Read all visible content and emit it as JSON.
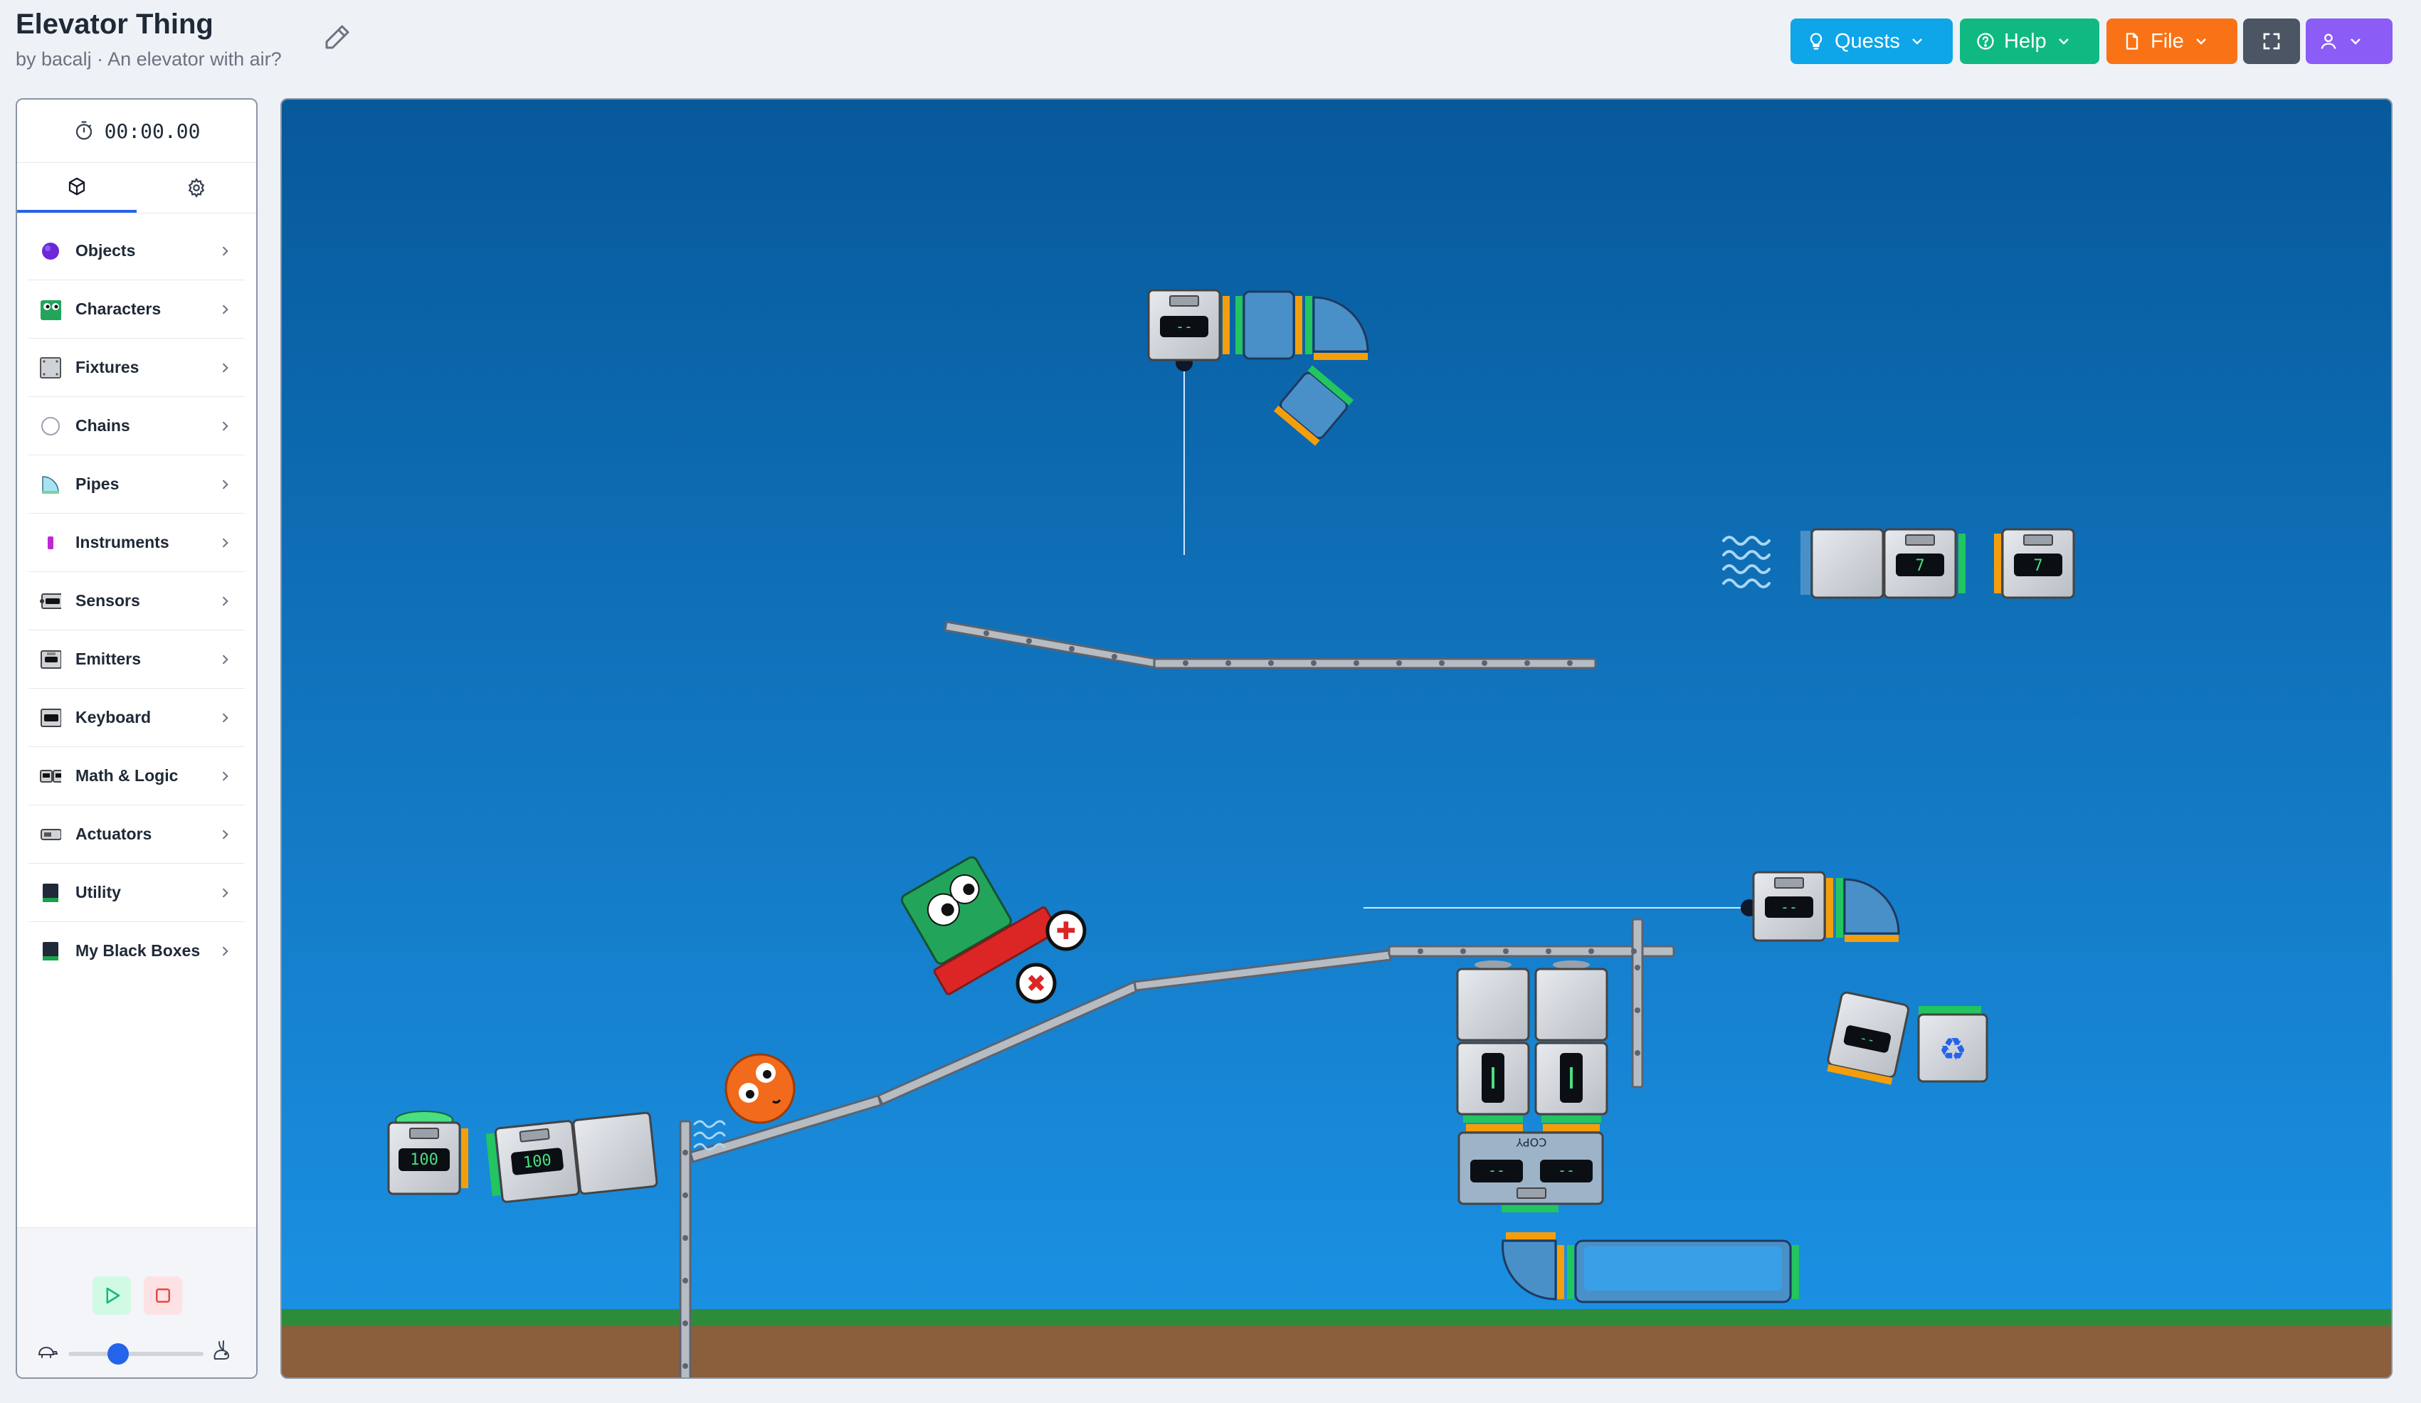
{
  "header": {
    "title": "Elevator Thing",
    "subtitle": "by bacalj · An elevator with air?",
    "edit_icon": "pencil-icon",
    "buttons": [
      {
        "label": "Quests",
        "color": "#0ea5e9",
        "icon": "lightbulb-icon"
      },
      {
        "label": "Help",
        "color": "#10b981",
        "icon": "help-circle-icon"
      },
      {
        "label": "File",
        "color": "#f97316",
        "icon": "file-icon"
      },
      {
        "label": "",
        "color": "#4b5563",
        "icon": "fullscreen-icon"
      },
      {
        "label": "",
        "color": "#8b5cf6",
        "icon": "user-icon"
      }
    ]
  },
  "sidebar": {
    "timer": "00:00.00",
    "tabs": [
      {
        "name": "objects",
        "icon": "cube-icon",
        "active": true
      },
      {
        "name": "settings",
        "icon": "gear-icon",
        "active": false
      }
    ],
    "categories": [
      {
        "label": "Objects",
        "icon": "purple-ball-icon"
      },
      {
        "label": "Characters",
        "icon": "green-character-icon"
      },
      {
        "label": "Fixtures",
        "icon": "fixture-panel-icon"
      },
      {
        "label": "Chains",
        "icon": "chain-ring-icon"
      },
      {
        "label": "Pipes",
        "icon": "pipe-icon"
      },
      {
        "label": "Instruments",
        "icon": "instrument-icon"
      },
      {
        "label": "Sensors",
        "icon": "sensor-icon"
      },
      {
        "label": "Emitters",
        "icon": "emitter-icon"
      },
      {
        "label": "Keyboard",
        "icon": "keyboard-icon"
      },
      {
        "label": "Math & Logic",
        "icon": "math-logic-icon"
      },
      {
        "label": "Actuators",
        "icon": "actuator-icon"
      },
      {
        "label": "Utility",
        "icon": "utility-icon"
      },
      {
        "label": "My Black Boxes",
        "icon": "black-box-icon"
      }
    ],
    "controls": {
      "play_icon": "play-icon",
      "stop_icon": "stop-icon",
      "slow_icon": "turtle-icon",
      "fast_icon": "rabbit-icon",
      "speed_fraction": 0.37
    }
  },
  "scene": {
    "sky_top": "#07599a",
    "sky_bottom": "#1c93e6",
    "grass": "#2e8b3a",
    "dirt": "#8b5e3c",
    "displays": {
      "emitter_top": "--",
      "counter_a": "7",
      "counter_b": "7",
      "emitter_right": "--",
      "left_a": "100",
      "left_b": "100",
      "tilted": "--",
      "pair_a": "--",
      "pair_b": "--",
      "copy_label": "COPY"
    }
  }
}
